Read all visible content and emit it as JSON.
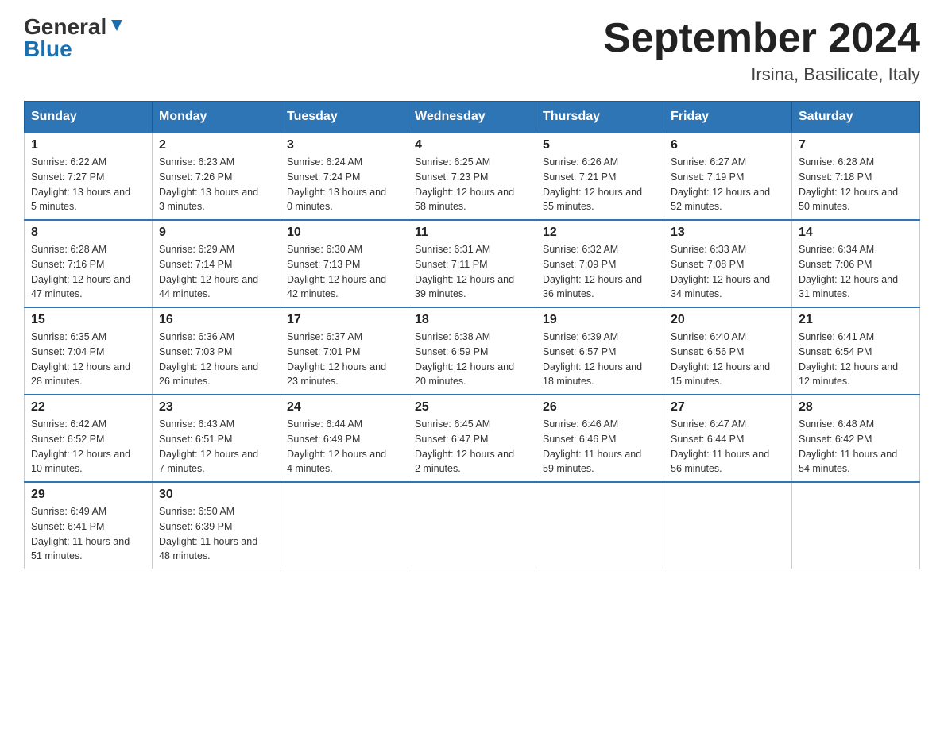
{
  "header": {
    "logo_general": "General",
    "logo_blue": "Blue",
    "month_title": "September 2024",
    "location": "Irsina, Basilicate, Italy"
  },
  "days_of_week": [
    "Sunday",
    "Monday",
    "Tuesday",
    "Wednesday",
    "Thursday",
    "Friday",
    "Saturday"
  ],
  "weeks": [
    [
      {
        "day": "1",
        "sunrise": "6:22 AM",
        "sunset": "7:27 PM",
        "daylight": "13 hours and 5 minutes."
      },
      {
        "day": "2",
        "sunrise": "6:23 AM",
        "sunset": "7:26 PM",
        "daylight": "13 hours and 3 minutes."
      },
      {
        "day": "3",
        "sunrise": "6:24 AM",
        "sunset": "7:24 PM",
        "daylight": "13 hours and 0 minutes."
      },
      {
        "day": "4",
        "sunrise": "6:25 AM",
        "sunset": "7:23 PM",
        "daylight": "12 hours and 58 minutes."
      },
      {
        "day": "5",
        "sunrise": "6:26 AM",
        "sunset": "7:21 PM",
        "daylight": "12 hours and 55 minutes."
      },
      {
        "day": "6",
        "sunrise": "6:27 AM",
        "sunset": "7:19 PM",
        "daylight": "12 hours and 52 minutes."
      },
      {
        "day": "7",
        "sunrise": "6:28 AM",
        "sunset": "7:18 PM",
        "daylight": "12 hours and 50 minutes."
      }
    ],
    [
      {
        "day": "8",
        "sunrise": "6:28 AM",
        "sunset": "7:16 PM",
        "daylight": "12 hours and 47 minutes."
      },
      {
        "day": "9",
        "sunrise": "6:29 AM",
        "sunset": "7:14 PM",
        "daylight": "12 hours and 44 minutes."
      },
      {
        "day": "10",
        "sunrise": "6:30 AM",
        "sunset": "7:13 PM",
        "daylight": "12 hours and 42 minutes."
      },
      {
        "day": "11",
        "sunrise": "6:31 AM",
        "sunset": "7:11 PM",
        "daylight": "12 hours and 39 minutes."
      },
      {
        "day": "12",
        "sunrise": "6:32 AM",
        "sunset": "7:09 PM",
        "daylight": "12 hours and 36 minutes."
      },
      {
        "day": "13",
        "sunrise": "6:33 AM",
        "sunset": "7:08 PM",
        "daylight": "12 hours and 34 minutes."
      },
      {
        "day": "14",
        "sunrise": "6:34 AM",
        "sunset": "7:06 PM",
        "daylight": "12 hours and 31 minutes."
      }
    ],
    [
      {
        "day": "15",
        "sunrise": "6:35 AM",
        "sunset": "7:04 PM",
        "daylight": "12 hours and 28 minutes."
      },
      {
        "day": "16",
        "sunrise": "6:36 AM",
        "sunset": "7:03 PM",
        "daylight": "12 hours and 26 minutes."
      },
      {
        "day": "17",
        "sunrise": "6:37 AM",
        "sunset": "7:01 PM",
        "daylight": "12 hours and 23 minutes."
      },
      {
        "day": "18",
        "sunrise": "6:38 AM",
        "sunset": "6:59 PM",
        "daylight": "12 hours and 20 minutes."
      },
      {
        "day": "19",
        "sunrise": "6:39 AM",
        "sunset": "6:57 PM",
        "daylight": "12 hours and 18 minutes."
      },
      {
        "day": "20",
        "sunrise": "6:40 AM",
        "sunset": "6:56 PM",
        "daylight": "12 hours and 15 minutes."
      },
      {
        "day": "21",
        "sunrise": "6:41 AM",
        "sunset": "6:54 PM",
        "daylight": "12 hours and 12 minutes."
      }
    ],
    [
      {
        "day": "22",
        "sunrise": "6:42 AM",
        "sunset": "6:52 PM",
        "daylight": "12 hours and 10 minutes."
      },
      {
        "day": "23",
        "sunrise": "6:43 AM",
        "sunset": "6:51 PM",
        "daylight": "12 hours and 7 minutes."
      },
      {
        "day": "24",
        "sunrise": "6:44 AM",
        "sunset": "6:49 PM",
        "daylight": "12 hours and 4 minutes."
      },
      {
        "day": "25",
        "sunrise": "6:45 AM",
        "sunset": "6:47 PM",
        "daylight": "12 hours and 2 minutes."
      },
      {
        "day": "26",
        "sunrise": "6:46 AM",
        "sunset": "6:46 PM",
        "daylight": "11 hours and 59 minutes."
      },
      {
        "day": "27",
        "sunrise": "6:47 AM",
        "sunset": "6:44 PM",
        "daylight": "11 hours and 56 minutes."
      },
      {
        "day": "28",
        "sunrise": "6:48 AM",
        "sunset": "6:42 PM",
        "daylight": "11 hours and 54 minutes."
      }
    ],
    [
      {
        "day": "29",
        "sunrise": "6:49 AM",
        "sunset": "6:41 PM",
        "daylight": "11 hours and 51 minutes."
      },
      {
        "day": "30",
        "sunrise": "6:50 AM",
        "sunset": "6:39 PM",
        "daylight": "11 hours and 48 minutes."
      },
      null,
      null,
      null,
      null,
      null
    ]
  ],
  "labels": {
    "sunrise": "Sunrise:",
    "sunset": "Sunset:",
    "daylight": "Daylight:"
  }
}
